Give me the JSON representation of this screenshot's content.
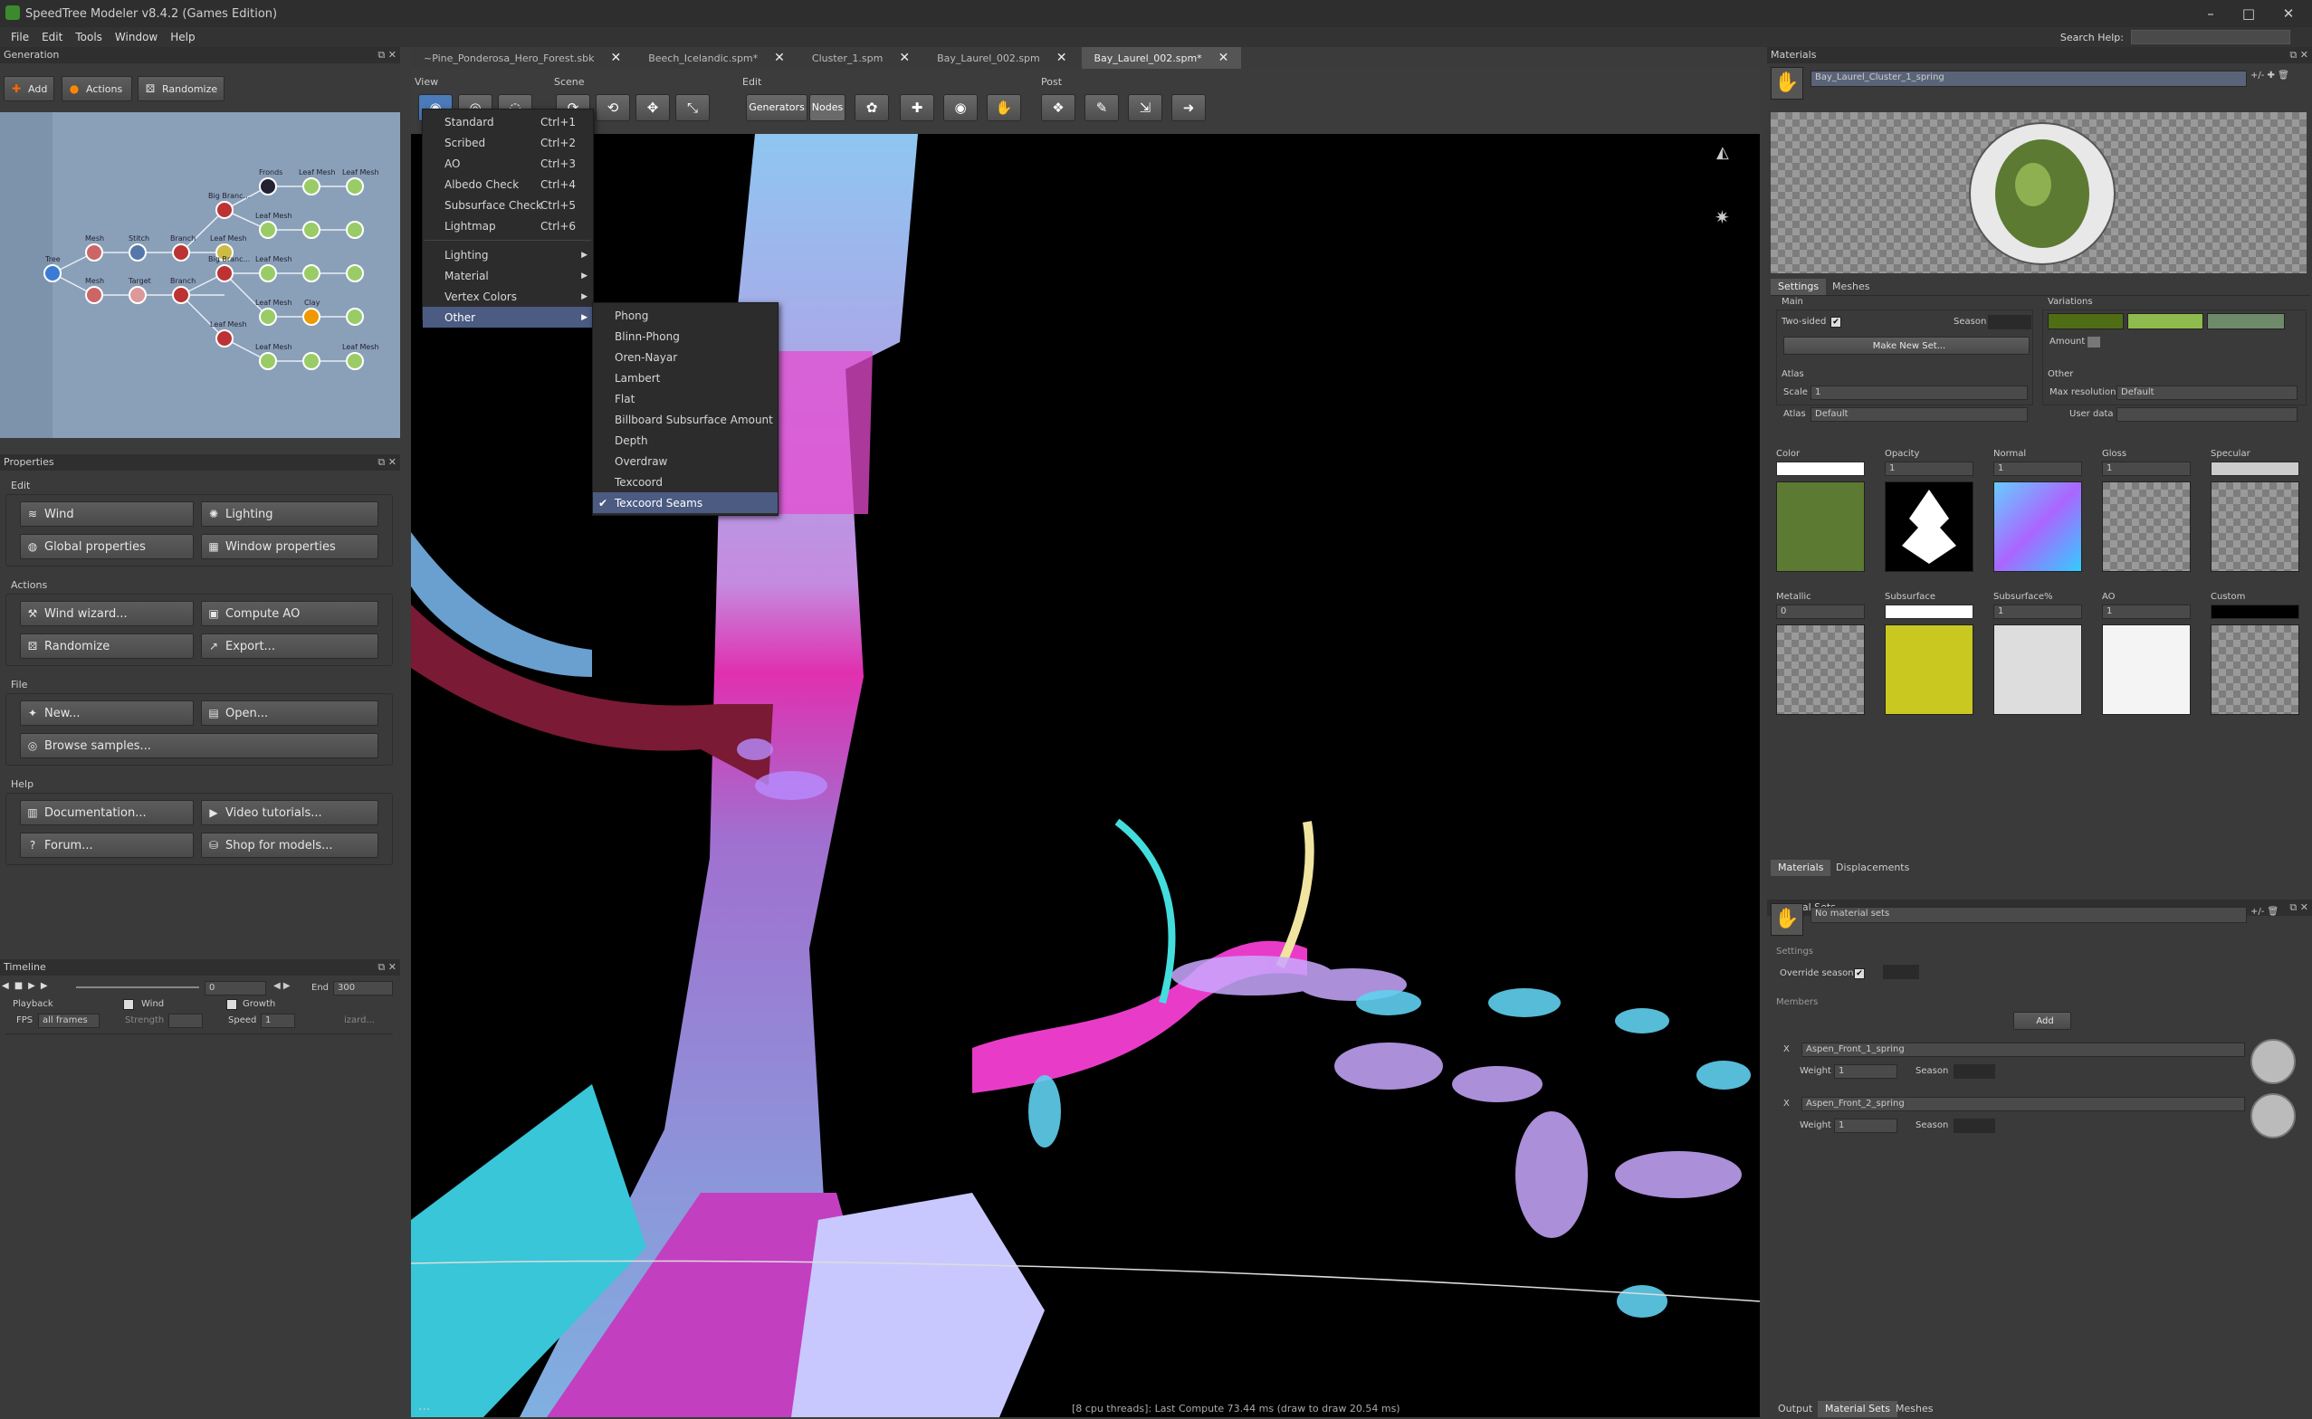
{
  "window": {
    "title": "SpeedTree Modeler v8.4.2 (Games Edition)"
  },
  "menubar": [
    "File",
    "Edit",
    "Tools",
    "Window",
    "Help"
  ],
  "search_help": {
    "label": "Search Help:"
  },
  "generation": {
    "title": "Generation",
    "buttons": [
      "Add",
      "Actions",
      "Randomize"
    ],
    "nodes": [
      "Tree",
      "Mesh",
      "Mesh",
      "Stitch",
      "Target",
      "Branch",
      "Branch",
      "Big Branc...",
      "Leaf Mesh",
      "Big Branc...",
      "Fronds",
      "Leaf Mesh",
      "Leaf Mesh",
      "Leaf Mesh",
      "Leaf Mesh",
      "Leaf Mesh",
      "Clay",
      "Leaf Mesh",
      "Leaf Mesh",
      "Leaf Mesh"
    ]
  },
  "properties": {
    "title": "Properties",
    "edit_label": "Edit",
    "edit_buttons": [
      "Wind",
      "Lighting",
      "Global properties",
      "Window properties"
    ],
    "actions_label": "Actions",
    "actions_buttons": [
      "Wind wizard...",
      "Compute AO",
      "Randomize",
      "Export..."
    ],
    "file_label": "File",
    "file_buttons": [
      "New...",
      "Open...",
      "Browse samples..."
    ],
    "help_label": "Help",
    "help_buttons": [
      "Documentation...",
      "Video tutorials...",
      "Forum...",
      "Shop for models..."
    ]
  },
  "timeline": {
    "title": "Timeline",
    "start": "0",
    "end_label": "End",
    "end": "300",
    "playback_label": "Playback",
    "fps_label": "FPS",
    "fps_value": "all frames",
    "wind_label": "Wind",
    "strength_label": "Strength",
    "growth_label": "Growth",
    "speed_label": "Speed",
    "speed_value": "1",
    "wizard_label": "izard..."
  },
  "tabs": [
    {
      "label": "~Pine_Ponderosa_Hero_Forest.sbk",
      "active": false
    },
    {
      "label": "Beech_Icelandic.spm*",
      "active": false
    },
    {
      "label": "Cluster_1.spm",
      "active": false
    },
    {
      "label": "Bay_Laurel_002.spm",
      "active": false
    },
    {
      "label": "Bay_Laurel_002.spm*",
      "active": true
    }
  ],
  "toolbar": {
    "groups": [
      "View",
      "Scene",
      "Edit",
      "Post"
    ],
    "edit_tabs": [
      "Generators",
      "Nodes"
    ]
  },
  "view_menu": {
    "items": [
      {
        "label": "Standard",
        "shortcut": "Ctrl+1"
      },
      {
        "label": "Scribed",
        "shortcut": "Ctrl+2"
      },
      {
        "label": "AO",
        "shortcut": "Ctrl+3"
      },
      {
        "label": "Albedo Check",
        "shortcut": "Ctrl+4"
      },
      {
        "label": "Subsurface Check",
        "shortcut": "Ctrl+5"
      },
      {
        "label": "Lightmap",
        "shortcut": "Ctrl+6"
      }
    ],
    "submenus": [
      "Lighting",
      "Material",
      "Vertex Colors",
      "Other"
    ]
  },
  "other_menu": {
    "items": [
      "Phong",
      "Blinn-Phong",
      "Oren-Nayar",
      "Lambert",
      "Flat",
      "Billboard Subsurface Amount",
      "Depth",
      "Overdraw",
      "Texcoord",
      "Texcoord Seams"
    ],
    "checked": "Texcoord Seams"
  },
  "viewport": {
    "status": "[8 cpu threads]: Last Compute 73.44 ms (draw to draw 20.54 ms)",
    "dots": "..."
  },
  "materials": {
    "title": "Materials",
    "selected": "Bay_Laurel_Cluster_1_spring",
    "tabs": [
      "Settings",
      "Meshes"
    ],
    "main_label": "Main",
    "two_sided": "Two-sided",
    "season": "Season",
    "make_new_set": "Make New Set...",
    "variations_label": "Variations",
    "variation_colors": [
      "#4f6d15",
      "#8fbb4e",
      "#6f8a6a"
    ],
    "amount": "Amount",
    "atlas_label": "Atlas",
    "scale_label": "Scale",
    "scale_value": "1",
    "atlas_field_label": "Atlas",
    "atlas_value": "Default",
    "other_label": "Other",
    "max_res_label": "Max resolution",
    "max_res_value": "Default",
    "user_data_label": "User data",
    "maps_row1": [
      {
        "label": "Color",
        "value": ""
      },
      {
        "label": "Opacity",
        "value": "1"
      },
      {
        "label": "Normal",
        "value": "1"
      },
      {
        "label": "Gloss",
        "value": "1"
      },
      {
        "label": "Specular",
        "value": ""
      }
    ],
    "maps_row2": [
      {
        "label": "Metallic",
        "value": "0"
      },
      {
        "label": "Subsurface",
        "value": ""
      },
      {
        "label": "Subsurface%",
        "value": "1"
      },
      {
        "label": "AO",
        "value": "1"
      },
      {
        "label": "Custom",
        "value": ""
      }
    ],
    "bottom_tabs": [
      "Materials",
      "Displacements"
    ]
  },
  "material_sets": {
    "title": "Material Sets",
    "selected": "No material sets",
    "settings_label": "Settings",
    "override_season": "Override season",
    "members_label": "Members",
    "add": "Add",
    "members": [
      {
        "name": "Aspen_Front_1_spring",
        "weight": "1"
      },
      {
        "name": "Aspen_Front_2_spring",
        "weight": "1"
      }
    ],
    "weight_label": "Weight",
    "season_label": "Season"
  },
  "bottom_tabs": [
    "Output",
    "Material Sets",
    "Meshes"
  ]
}
